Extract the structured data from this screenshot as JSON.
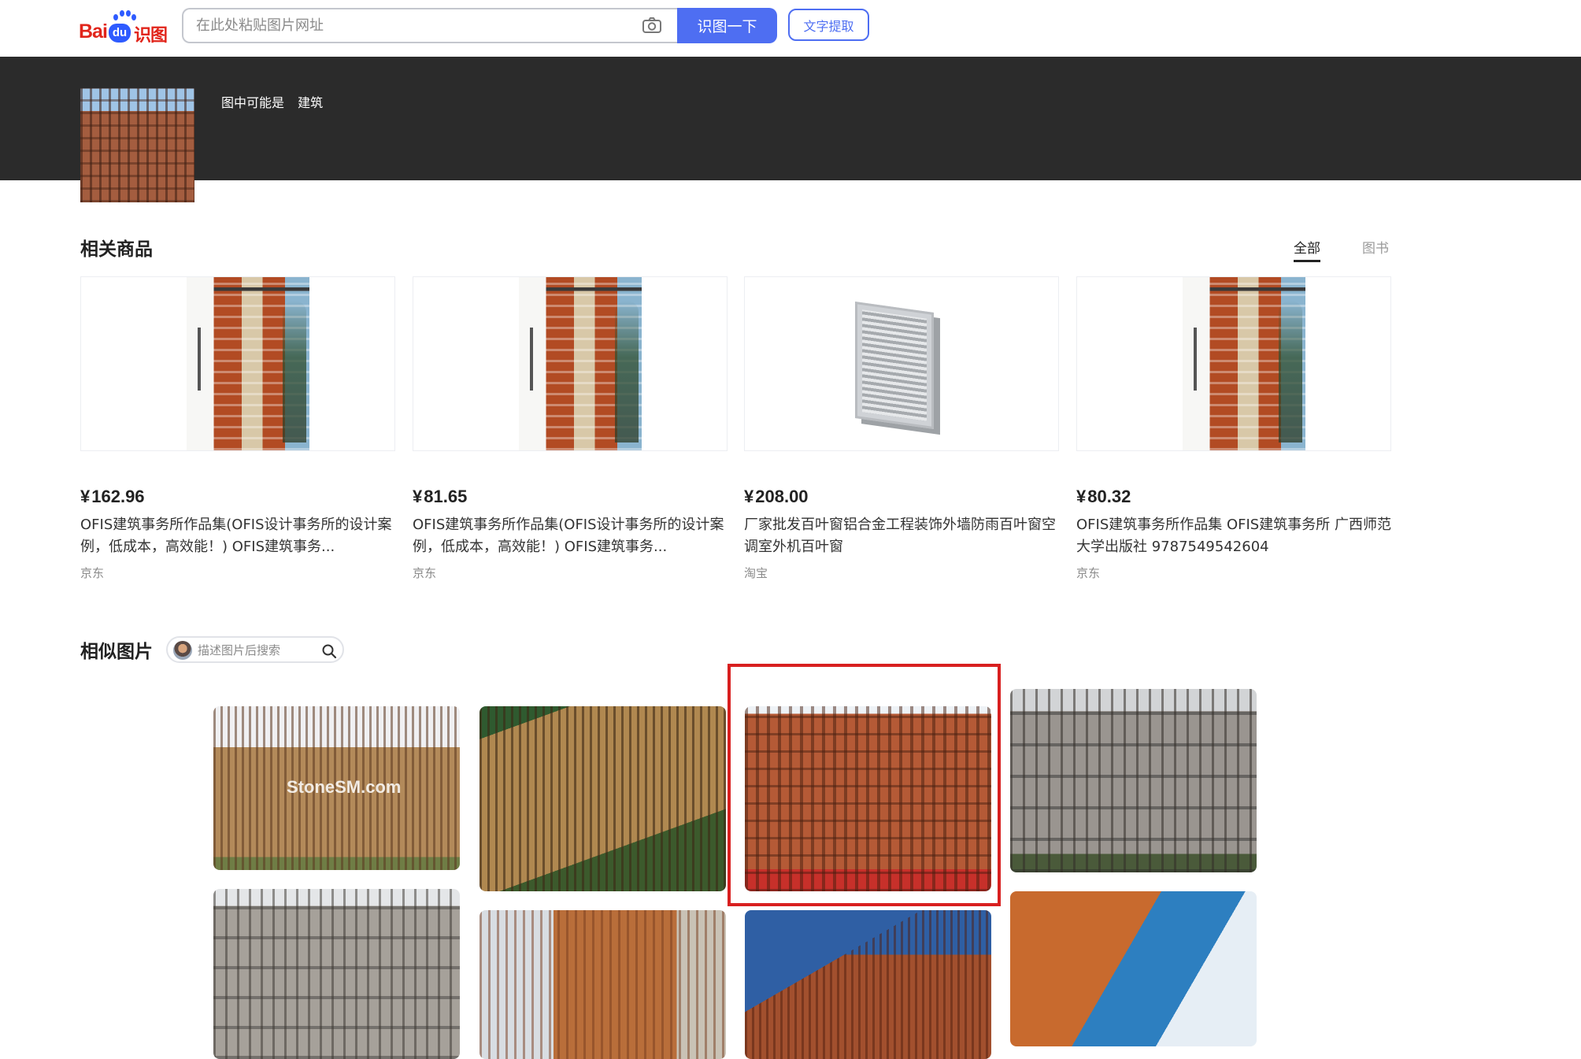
{
  "header": {
    "logo_text": {
      "bai": "Bai",
      "du": "du",
      "shitu": "识图"
    },
    "search_placeholder": "在此处粘贴图片网址",
    "search_button": "识图一下",
    "ocr_button": "文字提取",
    "icons": {
      "camera": "camera-icon"
    }
  },
  "result": {
    "label": "图中可能是",
    "value": "建筑"
  },
  "products_section": {
    "title": "相关商品",
    "tabs": [
      {
        "label": "全部",
        "active": true
      },
      {
        "label": "图书",
        "active": false
      }
    ],
    "items": [
      {
        "price": "162.96",
        "currency": "¥",
        "title": "OFIS建筑事务所作品集(OFIS设计事务所的设计案例，低成本，高效能！) OFIS建筑事务...",
        "source": "京东"
      },
      {
        "price": "81.65",
        "currency": "¥",
        "title": "OFIS建筑事务所作品集(OFIS设计事务所的设计案例，低成本，高效能！) OFIS建筑事务...",
        "source": "京东"
      },
      {
        "price": "208.00",
        "currency": "¥",
        "title": "厂家批发百叶窗铝合金工程装饰外墙防雨百叶窗空调室外机百叶窗",
        "source": "淘宝"
      },
      {
        "price": "80.32",
        "currency": "¥",
        "title": "OFIS建筑事务所作品集 OFIS建筑事务所 广西师范大学出版社 9787549542604",
        "source": "京东"
      }
    ]
  },
  "similar_section": {
    "title": "相似图片",
    "search_placeholder": "描述图片后搜索",
    "watermark_text": "StoneSM.com",
    "icons": {
      "search": "search-icon",
      "avatar": "avatar-icon"
    }
  },
  "colors": {
    "accent": "#4e6ef2",
    "brand_red": "#e1251b",
    "band": "#2b2b2b",
    "selection": "#d81f1f"
  }
}
